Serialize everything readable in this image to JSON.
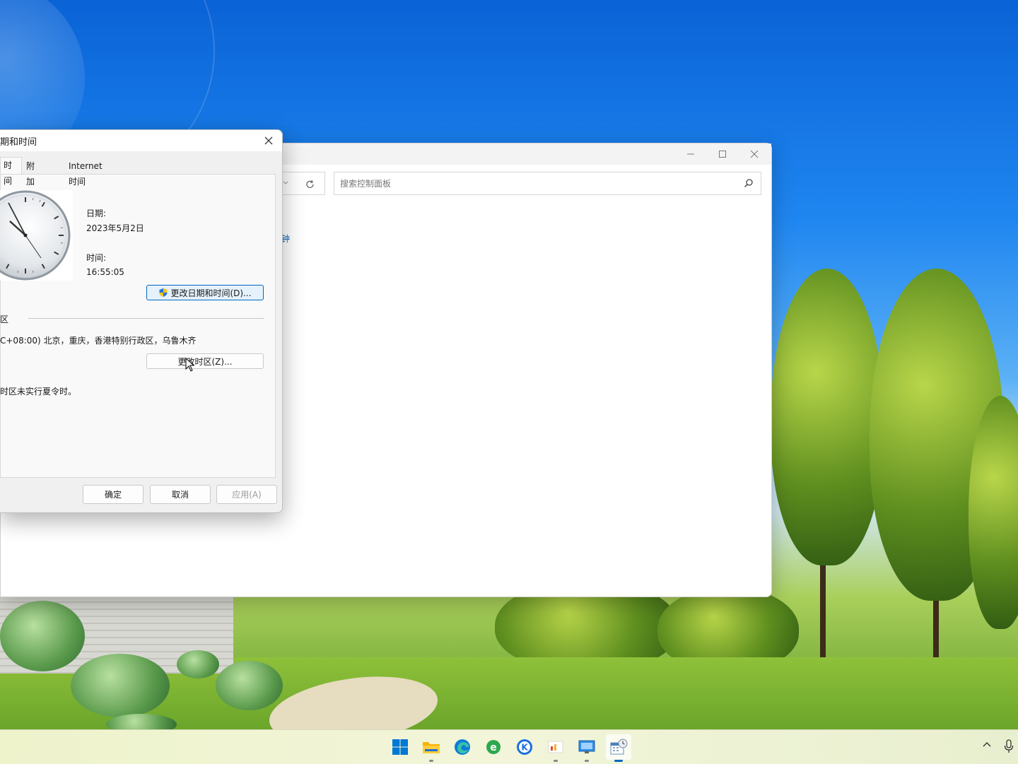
{
  "dialog": {
    "title": "期和时间",
    "tabs": [
      {
        "label": "时间"
      },
      {
        "label": "附加时钟"
      },
      {
        "label": "Internet 时间"
      }
    ],
    "date_label": "日期:",
    "date_value": "2023年5月2日",
    "time_label": "时间:",
    "time_value": "16:55:05",
    "change_datetime_button": "更改日期和时间(D)...",
    "timezone_section_label": "区",
    "timezone_value": "C+08:00) 北京，重庆，香港特别行政区，乌鲁木齐",
    "change_timezone_button": "更改时区(Z)...",
    "dst_note": "时区未实行夏令时。",
    "ok_button": "确定",
    "cancel_button": "取消",
    "apply_button": "应用(A)"
  },
  "control_panel": {
    "search_placeholder": "搜索控制面板",
    "partial_link": "钟"
  },
  "taskbar": {
    "items": [
      "windows-start",
      "file-explorer",
      "edge",
      "browser-e",
      "kuwo",
      "presentation",
      "remote-desktop",
      "date-time-settings"
    ]
  },
  "colors": {
    "accent": "#0067c0",
    "sky": "#1f86f0"
  }
}
